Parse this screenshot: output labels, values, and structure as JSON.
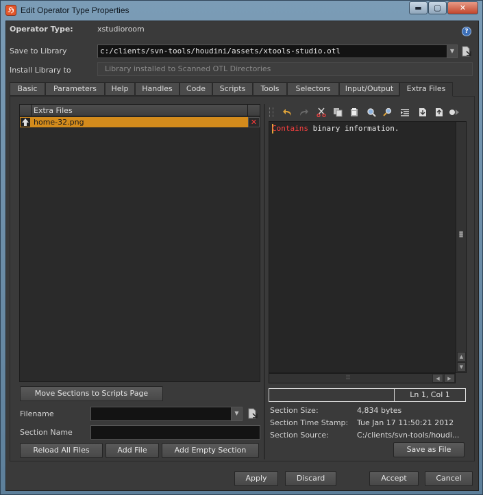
{
  "window": {
    "title": "Edit Operator Type Properties",
    "controls": {
      "minimize": "▬",
      "maximize": "▢",
      "close": "✕"
    }
  },
  "header": {
    "operator_type_label": "Operator Type:",
    "operator_type_value": "xstudioroom",
    "help_icon": "?",
    "save_to_library_label": "Save to Library",
    "save_to_library_value": "c:/clients/svn-tools/houdini/assets/xtools-studio.otl",
    "install_library_label": "Install Library to",
    "install_library_value": "Library installed to Scanned OTL Directories"
  },
  "tabs": [
    {
      "label": "Basic"
    },
    {
      "label": "Parameters"
    },
    {
      "label": "Help"
    },
    {
      "label": "Handles"
    },
    {
      "label": "Code"
    },
    {
      "label": "Scripts"
    },
    {
      "label": "Tools"
    },
    {
      "label": "Selectors"
    },
    {
      "label": "Input/Output"
    },
    {
      "label": "Extra Files",
      "active": true
    }
  ],
  "extra_files": {
    "column_header": "Extra Files",
    "rows": [
      {
        "name": "home-32.png",
        "selected": true
      }
    ],
    "move_sections_button": "Move Sections to Scripts Page",
    "filename_label": "Filename",
    "filename_value": "",
    "section_name_label": "Section Name",
    "section_name_value": "",
    "reload_button": "Reload All Files",
    "add_file_button": "Add File",
    "add_empty_button": "Add Empty Section"
  },
  "editor": {
    "content_keyword": "Contains",
    "content_rest": " binary information.",
    "cursor_position": "Ln 1, Col 1",
    "section_size_label": "Section Size:",
    "section_size_value": "4,834 bytes",
    "section_time_label": "Section Time Stamp:",
    "section_time_value": "Tue Jan 17 11:50:21 2012",
    "section_source_label": "Section Source:",
    "section_source_value": "C:/clients/svn-tools/houdi...",
    "save_as_file_button": "Save as File"
  },
  "footer": {
    "apply": "Apply",
    "discard": "Discard",
    "accept": "Accept",
    "cancel": "Cancel"
  },
  "colors": {
    "selected_row": "#d38b1c",
    "keyword": "#ff4040",
    "delete_x": "#ff3a3a"
  }
}
